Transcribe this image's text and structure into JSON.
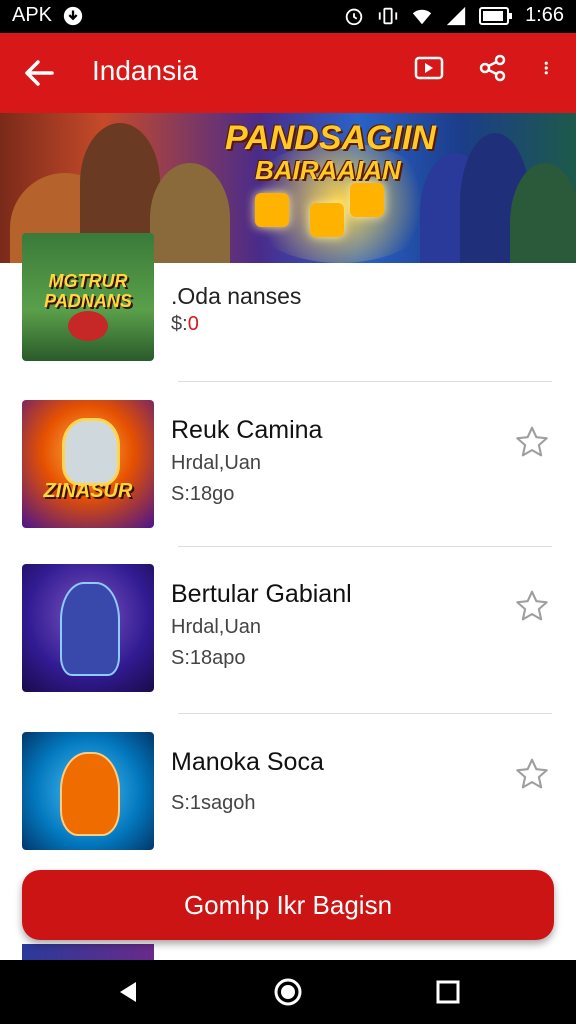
{
  "status_bar": {
    "left_text": "APK",
    "time": "1:66",
    "icons": [
      "download-icon",
      "alarm-icon",
      "vibrate-icon",
      "wifi-icon",
      "signal-icon",
      "battery-icon"
    ]
  },
  "app_bar": {
    "title": "Indansia",
    "actions": [
      "cast-icon",
      "share-icon",
      "more-vert-icon"
    ]
  },
  "banner": {
    "title_line1": "PANDSAGIIN",
    "title_line2": "BAIRAAIAN"
  },
  "items": [
    {
      "thumb_text": "MGTRUR PADNANS",
      "name": "",
      "subtitle": ".Oda nanses",
      "price_prefix": "$:",
      "price_value": "0",
      "starred": false
    },
    {
      "thumb_text": "ZINASUR",
      "name": "Reuk Camina",
      "subtitle": "Hrdal,Uan",
      "price_prefix": "S:",
      "price_value": "18go",
      "starred": false
    },
    {
      "thumb_text": "",
      "name": "Bertular Gabianl",
      "subtitle": "Hrdal,Uan",
      "price_prefix": "S:",
      "price_value": "18apo",
      "starred": false
    },
    {
      "thumb_text": "",
      "name": "Manoka Soca",
      "subtitle": "",
      "price_prefix": "S:",
      "price_value": "1sagoh",
      "starred": false
    }
  ],
  "cta": {
    "label": "Gomhp Ikr Bagisn"
  },
  "nav_bar": {
    "buttons": [
      "back-nav-icon",
      "home-nav-icon",
      "recents-nav-icon"
    ]
  },
  "colors": {
    "primary": "#d81818",
    "cta": "#cc1414",
    "price_accent": "#d81818"
  }
}
